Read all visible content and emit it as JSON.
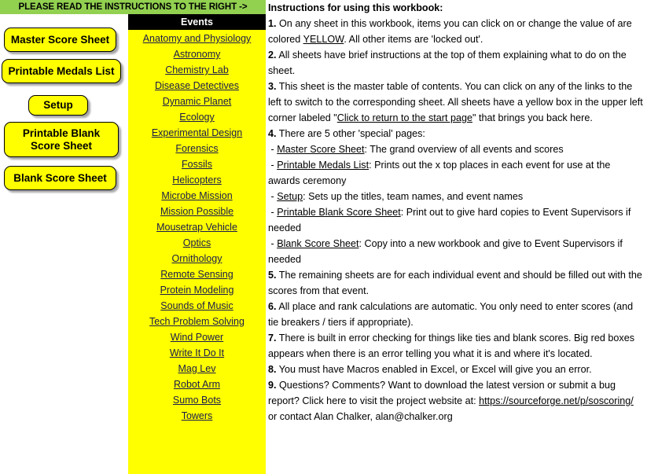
{
  "banner": {
    "text": "PLEASE READ THE INSTRUCTIONS TO THE RIGHT ->",
    "color": "#92D050"
  },
  "buttons": [
    {
      "id": "master",
      "label": "Master Score Sheet"
    },
    {
      "id": "medals",
      "label": "Printable Medals List"
    },
    {
      "id": "setup",
      "label": "Setup"
    },
    {
      "id": "pblank",
      "label": "Printable Blank Score Sheet"
    },
    {
      "id": "blank",
      "label": "Blank Score Sheet"
    }
  ],
  "button_labels": {
    "master": "Master Score Sheet",
    "medals": "Printable Medals List",
    "setup": "Setup",
    "pblank_line1": "Printable Blank",
    "pblank_line2": "Score Sheet",
    "blank": "Blank Score Sheet"
  },
  "events": {
    "header": "Events",
    "items": [
      "Anatomy and Physiology",
      "Astronomy",
      "Chemistry Lab",
      "Disease Detectives",
      "Dynamic Planet",
      "Ecology",
      "Experimental Design",
      "Forensics",
      "Fossils",
      "Helicopters",
      "Microbe Mission",
      "Mission Possible",
      "Mousetrap Vehicle",
      "Optics",
      "Ornithology",
      "Remote Sensing",
      "Protein Modeling",
      "Sounds of Music",
      "Tech Problem Solving",
      "Wind Power",
      "Write It Do It",
      "Mag Lev",
      "Robot Arm",
      "Sumo Bots",
      "Towers"
    ]
  },
  "instructions": {
    "title": "Instructions for using this workbook:",
    "n1": "1.",
    "p1a": "On any sheet in this workbook, items you can click on or change the value of are colored ",
    "p1_yellow": "YELLOW",
    "p1b": ".  All other items are 'locked out'.",
    "n2": "2.",
    "p2": "All sheets have brief instructions at the top of them explaining what to do on the sheet.",
    "n3": "3.",
    "p3a": "This sheet is the master table of contents.  You can click on any of the links to the left to switch to the corresponding sheet.  All sheets have a yellow box in the upper left corner labeled \"",
    "p3_link": "Click to return to the start page",
    "p3b": "\" that brings you back here.",
    "n4": "4.",
    "p4": "There are 5 other 'special' pages:",
    "b1_link": "Master Score Sheet",
    "b1_text": ":  The grand overview of all events and scores",
    "b2_link": "Printable Medals List",
    "b2_text": ": Prints out the x top places in each event for use at the awards ceremony",
    "b3_link": "Setup",
    "b3_text": ": Sets up the titles, team names, and event names",
    "b4_link": "Printable Blank Score Sheet",
    "b4_text": ": Print out to give hard copies to Event Supervisors if needed",
    "b5_link": "Blank Score Sheet",
    "b5_text": ":  Copy into a new workbook and give to Event Supervisors if needed",
    "bullet_dash": "-",
    "n5": "5.",
    "p5": "The remaining sheets are for each individual event and should be filled out with the scores from that event.",
    "n6": "6.",
    "p6": "All place and rank calculations are automatic.  You only need to enter scores (and tie breakers / tiers if appropriate).",
    "n7": "7.",
    "p7": "There is built in error checking for things like ties and blank scores.  Big red boxes appears when there is an error telling you what it is and where it's located.",
    "n8": "8.",
    "p8": "You must have Macros enabled in Excel, or Excel will give you an error.",
    "n9": "9.",
    "p9a": "Questions?  Comments?  Want to download the latest version or submit a bug report?  Click here to visit the project website at: ",
    "p9_url": "https://sourceforge.net/p/soscoring/",
    "p9b": " or contact Alan Chalker, alan@chalker.org"
  }
}
